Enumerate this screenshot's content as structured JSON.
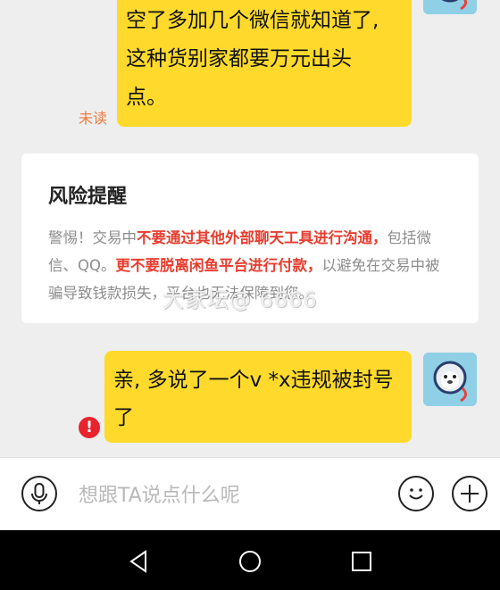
{
  "messages": [
    {
      "lines": [
        "空了多加几个微信就知道了,",
        "这种货别家都要万元出头",
        "点。"
      ],
      "status": "未读"
    },
    {
      "lines": [
        "亲, 多说了一个v *x违规被封号",
        "了"
      ],
      "status_icon": "error-icon"
    }
  ],
  "risk_notice": {
    "title": "风险提醒",
    "segments": [
      {
        "text": "警惕！交易中",
        "style": "normal"
      },
      {
        "text": "不要通过其他外部聊天工具进行沟通，",
        "style": "red"
      },
      {
        "text": "包括微信、QQ。",
        "style": "normal"
      },
      {
        "text": "更不要脱离闲鱼平台进行付款，",
        "style": "red"
      },
      {
        "text": "以避免在交易中被骗导致钱款损失，平台也无法保障到您。",
        "style": "normal"
      }
    ]
  },
  "watermark": "大家坛@ 6666",
  "input_bar": {
    "placeholder": "想跟TA说点什么呢",
    "value": "",
    "icons": [
      "microphone-icon",
      "emoji-icon",
      "plus-icon"
    ]
  },
  "nav_bar": {
    "icons": [
      "back-icon",
      "home-icon",
      "recents-icon"
    ]
  },
  "colors": {
    "bubble": "#ffda2c",
    "unread": "#f07a3e",
    "warning_red": "#e83d2f",
    "error": "#e8232d",
    "background": "#eeeeee"
  }
}
